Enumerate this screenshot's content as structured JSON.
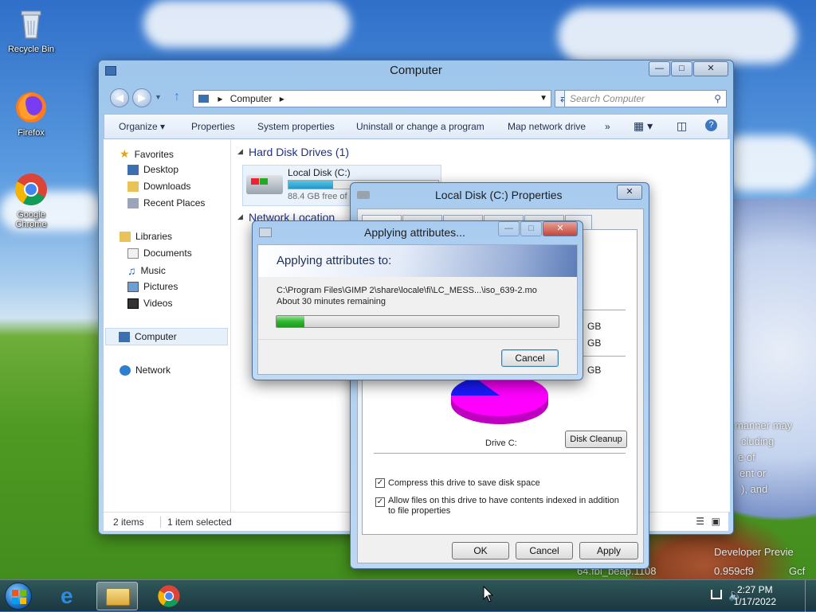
{
  "desktop": {
    "icons": [
      {
        "label": "Recycle Bin"
      },
      {
        "label": "Firefox"
      },
      {
        "label": "Google Chrome"
      }
    ],
    "watermark_lines": [
      "manner may",
      "cluding",
      "e of",
      "ent or",
      "), and",
      "Developer Previe",
      "64.fbl_beap.1108",
      "0.959cf9",
      "Gcf"
    ]
  },
  "explorer": {
    "title": "Computer",
    "address": "Computer",
    "search_placeholder": "Search Computer",
    "toolbar": [
      "Organize",
      "Properties",
      "System properties",
      "Uninstall or change a program",
      "Map network drive",
      "»"
    ],
    "nav": {
      "favorites": "Favorites",
      "favorites_items": [
        "Desktop",
        "Downloads",
        "Recent Places"
      ],
      "libraries": "Libraries",
      "libraries_items": [
        "Documents",
        "Music",
        "Pictures",
        "Videos"
      ],
      "computer": "Computer",
      "network": "Network"
    },
    "groups": {
      "hdd_header": "Hard Disk Drives (1)",
      "net_header": "Network Location",
      "drive_name": "Local Disk (C:)",
      "drive_free": "88.4 GB free of",
      "drive_used_fraction": 0.3
    },
    "status": {
      "items": "2 items",
      "selected": "1 item selected"
    }
  },
  "properties": {
    "title": "Local Disk (C:) Properties",
    "gb_labels": [
      "GB",
      "GB",
      "GB"
    ],
    "drive_label": "Drive C:",
    "disk_cleanup": "Disk Cleanup",
    "compress_label": "Compress this drive to save disk space",
    "index_label": "Allow files on this drive to have contents indexed in addition to file properties",
    "ok": "OK",
    "cancel": "Cancel",
    "apply": "Apply",
    "colors": {
      "used": "#1a1aff",
      "free": "#ff00ff"
    }
  },
  "applying": {
    "title": "Applying attributes...",
    "heading": "Applying attributes to:",
    "path": "C:\\Program Files\\GIMP 2\\share\\locale\\fi\\LC_MESS...\\iso_639-2.mo",
    "remaining": "About 30 minutes remaining",
    "progress_fraction": 0.1,
    "cancel": "Cancel"
  },
  "taskbar": {
    "time": "2:27 PM",
    "date": "1/17/2022"
  }
}
